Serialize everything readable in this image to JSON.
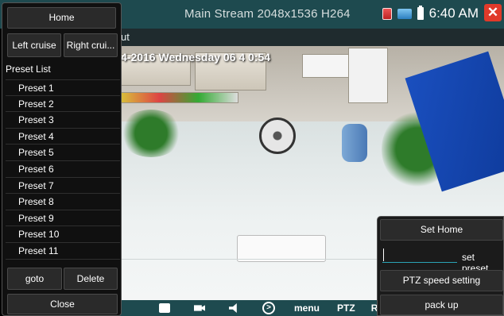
{
  "header": {
    "stream_title": "Main Stream 2048x1536 H264",
    "clock": "6:40 AM",
    "icons": [
      "sd-card-icon",
      "network-icon",
      "battery-icon",
      "close-icon"
    ],
    "close_glyph": "✕"
  },
  "subbar": {
    "text": "ut"
  },
  "feed": {
    "osd_timestamp": "4-2016 Wednesday 06 4 0:54"
  },
  "toolbar": {
    "menu_label": "menu",
    "ptz_label": "PTZ",
    "rt_label": "RT"
  },
  "left_panel": {
    "home_label": "Home",
    "left_cruise_label": "Left cruise",
    "right_cruise_label": "Right crui...",
    "preset_list_label": "Preset List",
    "presets": [
      "Preset 1",
      "Preset 2",
      "Preset 3",
      "Preset 4",
      "Preset 5",
      "Preset 6",
      "Preset 7",
      "Preset 8",
      "Preset 9",
      "Preset 10",
      "Preset 11"
    ],
    "goto_label": "goto",
    "delete_label": "Delete",
    "close_label": "Close"
  },
  "right_panel": {
    "set_home_label": "Set Home",
    "preset_input_value": "",
    "set_preset_label": "set preset",
    "speed_label": "PTZ speed setting",
    "pack_up_label": "pack up"
  }
}
